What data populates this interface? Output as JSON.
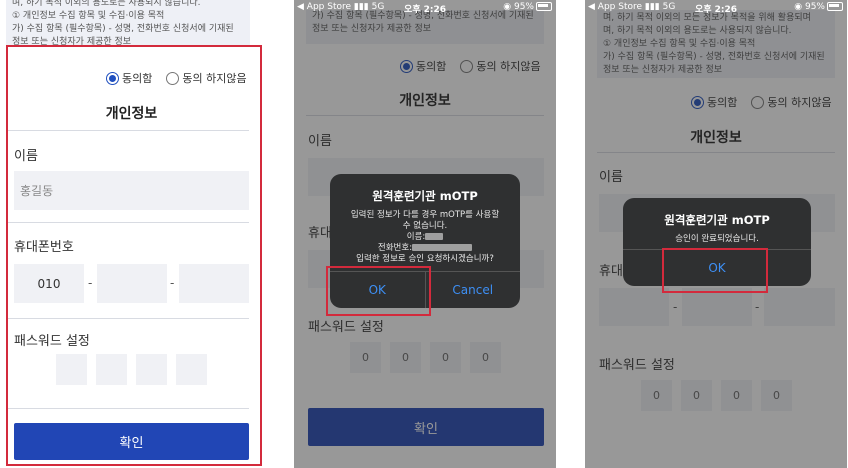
{
  "consent": {
    "line1": "며, 하기 목적 이외의 용도로는 사용되지 않습니다.",
    "line2": "① 개인정보 수집 항목 및 수집·이용 목적",
    "line3": "가) 수집 항목 (필수항목) - 성명, 전화번호 신청서에 기재된",
    "line4": "정보 또는 신청자가 제공한 정보",
    "p3_line0": "며, 하기 목적 이외의 모든 정보가 목적을 위해 활용되며",
    "agree": "동의함",
    "disagree": "동의 하지않음"
  },
  "form": {
    "section_title": "개인정보",
    "name_label": "이름",
    "name_placeholder": "홍길동",
    "phone_label": "휴대폰번호",
    "phone_prefix": "010",
    "dash": "-",
    "password_label": "패스워드 설정",
    "pw_digit": "0",
    "confirm_button": "확인"
  },
  "status_bar": {
    "carrier": "◀ App Store",
    "network": "5G",
    "time": "오후 2:26",
    "battery": "95%"
  },
  "dialog_confirm": {
    "title": "원격훈련기관 mOTP",
    "line1": "입력된 정보가 다를 경우 mOTP를 사용할",
    "line2": "수 없습니다.",
    "name_prefix": "이름:",
    "phone_prefix": "전화번호:",
    "question": "입력한 정보로 승인 요청하시겠습니까?",
    "ok": "OK",
    "cancel": "Cancel"
  },
  "dialog_done": {
    "title": "원격훈련기관 mOTP",
    "message": "승인이 완료되었습니다.",
    "ok": "OK"
  },
  "colors": {
    "primary": "#2146b5",
    "highlight": "#d32a3c",
    "ios_link": "#3d8ff5"
  }
}
